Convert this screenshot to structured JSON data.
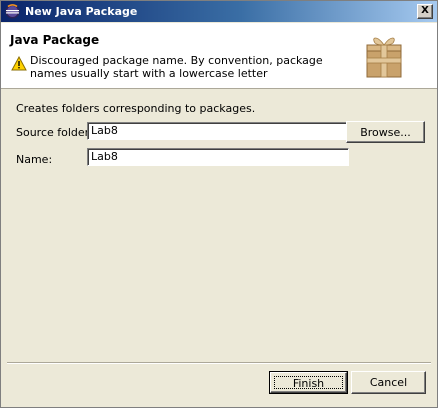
{
  "window": {
    "title": "New Java Package",
    "close_symbol": "X"
  },
  "header": {
    "title": "Java Package",
    "message": "Discouraged package name. By convention, package names usually start with a lowercase letter",
    "warning_icon": "warning-triangle",
    "illustration_icon": "package-box"
  },
  "body": {
    "description": "Creates folders corresponding to packages.",
    "source_folder": {
      "label": "Source folder:",
      "value": "Lab8"
    },
    "name": {
      "label": "Name:",
      "value": "Lab8"
    },
    "browse_label": "Browse..."
  },
  "footer": {
    "finish_label": "Finish",
    "cancel_label": "Cancel"
  },
  "colors": {
    "dialog_bg": "#ece9d8",
    "titlebar_start": "#0a246a",
    "titlebar_end": "#a6caf0",
    "warning_fill": "#ffd200"
  }
}
